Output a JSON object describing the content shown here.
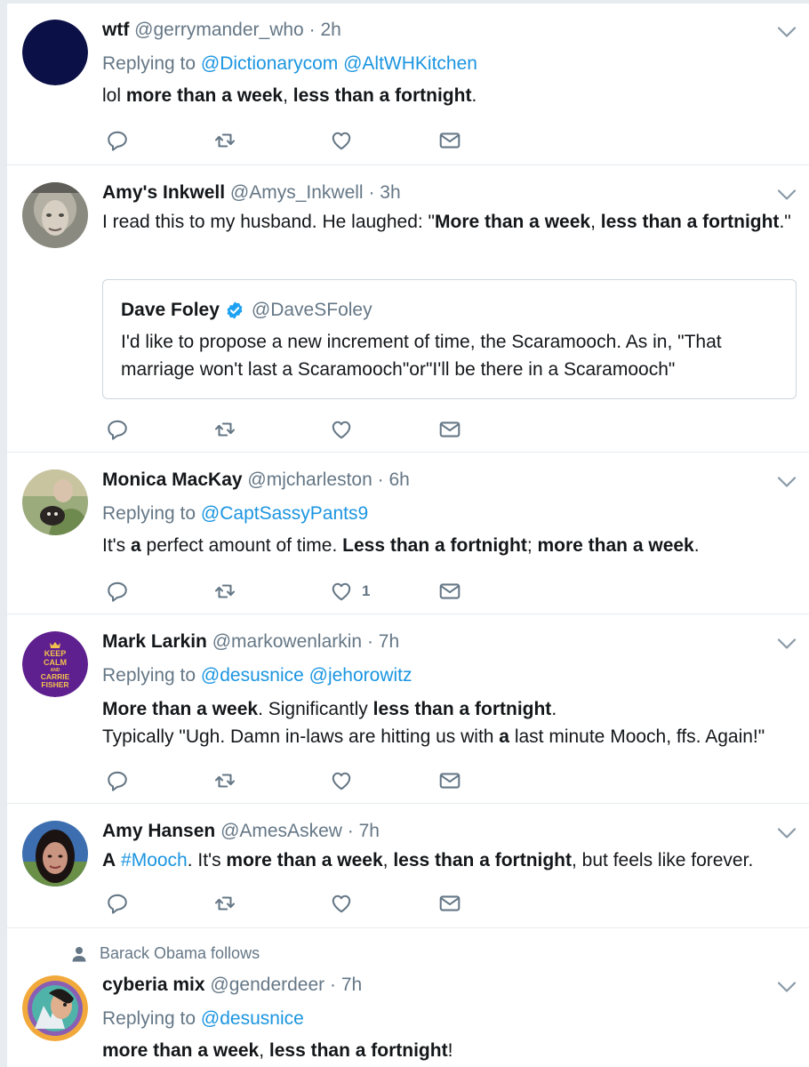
{
  "colors": {
    "link": "#1b95e0",
    "secondary_text": "#657786",
    "primary_text": "#14171a",
    "divider": "#e6ecf0",
    "verified_badge": "#1da1f2"
  },
  "icons": {
    "reply": "reply-icon",
    "retweet": "retweet-icon",
    "like": "heart-icon",
    "dm": "envelope-icon",
    "menu": "chevron-down-icon",
    "verified": "verified-badge-icon",
    "follows": "person-icon"
  },
  "tweets": [
    {
      "name": "wtf",
      "handle": "@gerrymander_who",
      "dot": "·",
      "time": "2h",
      "replying_prefix": "Replying to",
      "mentions": [
        "@Dictionarycom",
        "@AltWHKitchen"
      ],
      "text": {
        "t0": "lol ",
        "b1": "more than a week",
        "t2": ", ",
        "b3": "less than a fortnight",
        "t4": "."
      }
    },
    {
      "name": "Amy's Inkwell",
      "handle": "@Amys_Inkwell",
      "dot": "·",
      "time": "3h",
      "text": {
        "t0": "I read this to my husband. He laughed: \"",
        "b1": "More than a week",
        "t2": ", ",
        "b3": "less than a fortnight",
        "t4": ".\""
      },
      "quote": {
        "name": "Dave Foley",
        "handle": "@DaveSFoley",
        "text": "I'd like to propose a new increment of time, the Scaramooch. As in, \"That marriage won't last a Scaramooch\"or\"I'll be there in a Scaramooch\""
      }
    },
    {
      "name": "Monica MacKay",
      "handle": "@mjcharleston",
      "dot": "·",
      "time": "6h",
      "replying_prefix": "Replying to",
      "mentions": [
        "@CaptSassyPants9"
      ],
      "text": {
        "t0": "It's ",
        "b1": "a",
        "t2": " perfect amount of time. ",
        "b3": "Less than a fortnight",
        "t4": "; ",
        "b5": "more than a week",
        "t6": "."
      },
      "like_count": "1"
    },
    {
      "name": "Mark Larkin",
      "handle": "@markowenlarkin",
      "dot": "·",
      "time": "7h",
      "replying_prefix": "Replying to",
      "mentions": [
        "@desusnice",
        "@jehorowitz"
      ],
      "avatar_text": [
        "KEEP",
        "CALM",
        "AND",
        "CARRIE",
        "FISHER"
      ],
      "text": {
        "b0": "More than a week",
        "t1": ". Significantly ",
        "b2": "less than a fortnight",
        "t3": ".",
        "t4": "Typically \"Ugh. Damn in-laws are hitting us with ",
        "b5": "a",
        "t6": " last minute Mooch, ffs. Again!\""
      }
    },
    {
      "name": "Amy Hansen",
      "handle": "@AmesAskew",
      "dot": "·",
      "time": "7h",
      "text": {
        "b0": "A",
        "t1": " ",
        "h2": "#Mooch",
        "t3": ". It's ",
        "b4": "more than a week",
        "t5": ", ",
        "b6": "less than a fortnight",
        "t7": ", but feels like forever."
      }
    },
    {
      "social_context": "Barack Obama follows",
      "name": "cyberia mix",
      "handle": "@genderdeer",
      "dot": "·",
      "time": "7h",
      "replying_prefix": "Replying to",
      "mentions": [
        "@desusnice"
      ],
      "text": {
        "b0": "more than a week",
        "t1": ", ",
        "b2": "less than a fortnight",
        "t3": "!"
      }
    }
  ]
}
